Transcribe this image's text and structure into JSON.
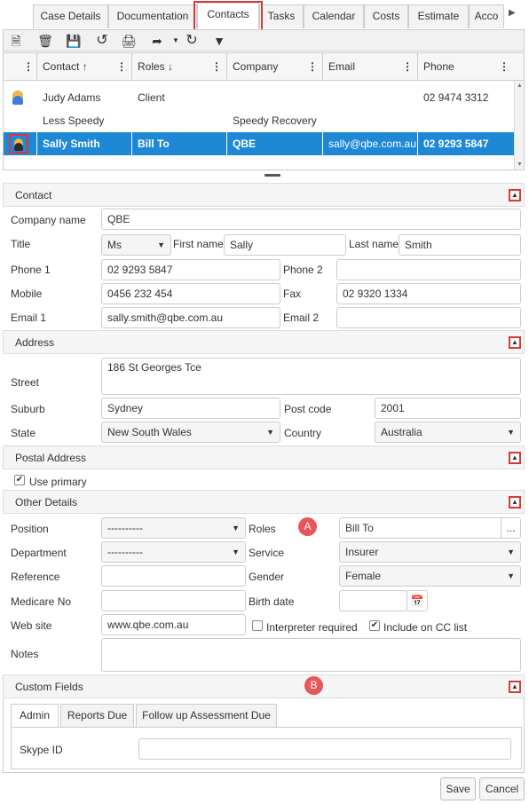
{
  "tabs": [
    "Case Details",
    "Documentation",
    "Contacts",
    "Tasks",
    "Calendar",
    "Costs",
    "Estimate",
    "Acco"
  ],
  "active_tab": "Contacts",
  "toolbar_icons": [
    "new-icon",
    "delete-icon",
    "save-icon",
    "undo-icon",
    "print-icon",
    "export-icon",
    "refresh-icon",
    "filter-icon"
  ],
  "grid": {
    "headers": {
      "contact": "Contact ↑",
      "roles": "Roles ↓",
      "company": "Company",
      "email": "Email",
      "phone": "Phone"
    },
    "rows": [
      {
        "contact": "Judy Adams",
        "roles": "Client",
        "company": "",
        "email": "",
        "phone": "02 9474 3312"
      },
      {
        "contact": "Less Speedy",
        "roles": "",
        "company": "Speedy Recovery",
        "email": "",
        "phone": ""
      },
      {
        "contact": "Sally Smith",
        "roles": "Bill To",
        "company": "QBE",
        "email": "sally@qbe.com.au",
        "phone": "02 9293 5847"
      }
    ]
  },
  "contact": {
    "section": "Contact",
    "company_name_label": "Company name",
    "company_name": "QBE",
    "title_label": "Title",
    "title": "Ms",
    "first_name_label": "First name",
    "first_name": "Sally",
    "last_name_label": "Last name",
    "last_name": "Smith",
    "phone1_label": "Phone 1",
    "phone1": "02 9293 5847",
    "phone2_label": "Phone 2",
    "phone2": "",
    "mobile_label": "Mobile",
    "mobile": "0456 232 454",
    "fax_label": "Fax",
    "fax": "02 9320 1334",
    "email1_label": "Email 1",
    "email1": "sally.smith@qbe.com.au",
    "email2_label": "Email 2",
    "email2": ""
  },
  "address": {
    "section": "Address",
    "street_label": "Street",
    "street": "186 St Georges Tce",
    "suburb_label": "Suburb",
    "suburb": "Sydney",
    "postcode_label": "Post code",
    "postcode": "2001",
    "state_label": "State",
    "state": "New South Wales",
    "country_label": "Country",
    "country": "Australia"
  },
  "postal": {
    "section": "Postal Address",
    "use_primary_label": "Use primary",
    "use_primary": true
  },
  "other": {
    "section": "Other Details",
    "position_label": "Position",
    "position": "----------",
    "roles_label": "Roles",
    "roles": "Bill To",
    "roles_button": "...",
    "department_label": "Department",
    "department": "----------",
    "service_label": "Service",
    "service": "Insurer",
    "reference_label": "Reference",
    "reference": "",
    "gender_label": "Gender",
    "gender": "Female",
    "medicare_label": "Medicare No",
    "medicare": "",
    "birthdate_label": "Birth date",
    "birthdate": "",
    "website_label": "Web site",
    "website": "www.qbe.com.au",
    "interpreter_label": "Interpreter required",
    "interpreter": false,
    "cc_label": "Include on CC list",
    "cc": true,
    "notes_label": "Notes",
    "notes": ""
  },
  "custom": {
    "section": "Custom Fields",
    "tabs": [
      "Admin",
      "Reports Due",
      "Follow up Assessment Due"
    ],
    "skype_label": "Skype ID",
    "skype": ""
  },
  "badges": {
    "a": "A",
    "b": "B"
  },
  "buttons": {
    "save": "Save",
    "cancel": "Cancel"
  },
  "colors": {
    "accent": "#1e88d6",
    "highlight": "#d23b3b",
    "badge": "#e8565a"
  }
}
